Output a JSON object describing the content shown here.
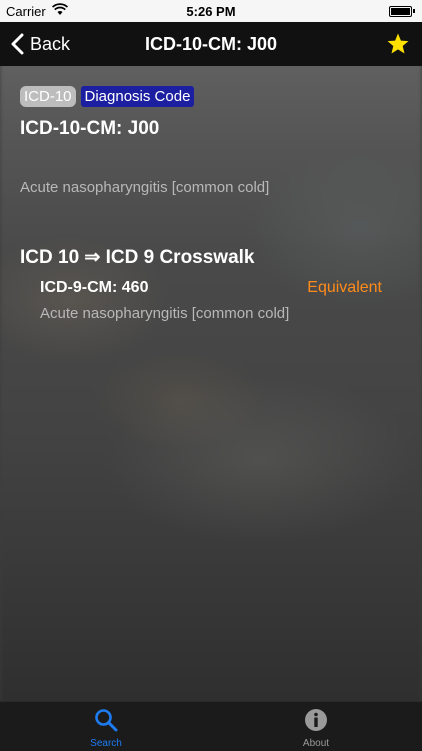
{
  "status_bar": {
    "carrier": "Carrier",
    "time": "5:26 PM"
  },
  "nav": {
    "back_label": "Back",
    "title": "ICD-10-CM: J00",
    "favorite_icon": "star-icon",
    "favorite_color": "#ffe100"
  },
  "badges": {
    "version": "ICD-10",
    "type": "Diagnosis Code"
  },
  "code": {
    "title": "ICD-10-CM: J00",
    "description": "Acute nasopharyngitis [common cold]"
  },
  "crosswalk": {
    "title": "ICD 10 ⇒ ICD 9 Crosswalk",
    "code": "ICD-9-CM: 460",
    "match": "Equivalent",
    "description": "Acute nasopharyngitis [common cold]"
  },
  "tabs": [
    {
      "label": "Search",
      "icon": "search-icon",
      "active": true
    },
    {
      "label": "About",
      "icon": "info-icon",
      "active": false
    }
  ],
  "colors": {
    "accent": "#1e7cf2",
    "equivalent": "#ff8c1a",
    "badge_blue": "#1b1fa0"
  }
}
